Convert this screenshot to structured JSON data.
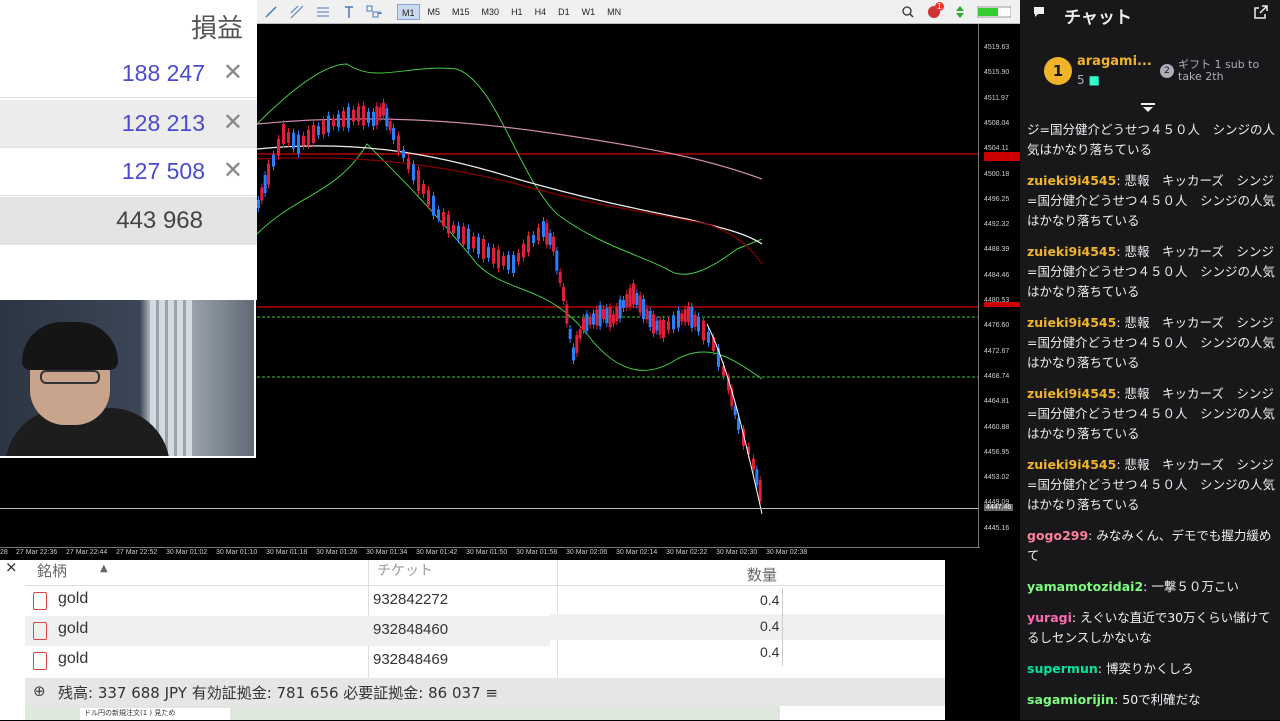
{
  "pl_panel": {
    "header": "損益",
    "rows": [
      {
        "value": "188 247",
        "close": "✕"
      },
      {
        "value": "128 213",
        "close": "✕"
      },
      {
        "value": "127 508",
        "close": "✕"
      }
    ],
    "total": "443 968"
  },
  "toolbar": {
    "timeframes": [
      "M1",
      "M5",
      "M15",
      "M30",
      "H1",
      "H4",
      "D1",
      "W1",
      "MN"
    ],
    "active_timeframe": "M1",
    "alert_badge": "1"
  },
  "price_axis": {
    "labels": [
      "4519.63",
      "4515.90",
      "4511.97",
      "4508.04",
      "4504.11",
      "4500.18",
      "4496.25",
      "4492.32",
      "4488.39",
      "4484.46",
      "4480.53",
      "4476.60",
      "4472.67",
      "4468.74",
      "4464.81",
      "4460.88",
      "4456.95",
      "4453.02",
      "4449.09",
      "4445.16"
    ],
    "current_price": "4447.46"
  },
  "time_axis": {
    "labels": [
      "28",
      "27 Mar 22:36",
      "27 Mar 22:44",
      "27 Mar 22:52",
      "30 Mar 01:02",
      "30 Mar 01:10",
      "30 Mar 01:18",
      "30 Mar 01:26",
      "30 Mar 01:34",
      "30 Mar 01:42",
      "30 Mar 01:50",
      "30 Mar 01:58",
      "30 Mar 02:06",
      "30 Mar 02:14",
      "30 Mar 02:22",
      "30 Mar 02:30",
      "30 Mar 02:38"
    ]
  },
  "positions": {
    "close": "×",
    "headers": {
      "symbol": "銘柄",
      "ticket": "チケット",
      "qty": "数量"
    },
    "rows": [
      {
        "symbol": "gold",
        "ticket": "932842272",
        "qty": "0.4"
      },
      {
        "symbol": "gold",
        "ticket": "932848460",
        "qty": "0.4"
      },
      {
        "symbol": "gold",
        "ticket": "932848469",
        "qty": "0.4"
      }
    ],
    "balance": "残高: 337 688 JPY  有効証拠金: 781 656  必要証拠金: 86 037  ≡"
  },
  "taskbar": {
    "tab": "ドル円の新規注文(1 ) 見ため"
  },
  "chat": {
    "title": "チャット",
    "gift": {
      "rank": "1",
      "user": "aragami...",
      "count": "5",
      "rank2": "2",
      "text": "ギフト 1 sub to take 2th"
    },
    "messages": [
      {
        "user": "",
        "color": "#efeff1",
        "text": "ジ=国分健介どうせつ４５０人　シンジの人気はかなり落ちている"
      },
      {
        "user": "zuieki9i4545",
        "color": "#f0b429",
        "text": "悲報　キッカーズ　シンジ=国分健介どうせつ４５０人　シンジの人気はかなり落ちている"
      },
      {
        "user": "zuieki9i4545",
        "color": "#f0b429",
        "text": "悲報　キッカーズ　シンジ=国分健介どうせつ４５０人　シンジの人気はかなり落ちている"
      },
      {
        "user": "zuieki9i4545",
        "color": "#f0b429",
        "text": "悲報　キッカーズ　シンジ=国分健介どうせつ４５０人　シンジの人気はかなり落ちている"
      },
      {
        "user": "zuieki9i4545",
        "color": "#f0b429",
        "text": "悲報　キッカーズ　シンジ=国分健介どうせつ４５０人　シンジの人気はかなり落ちている"
      },
      {
        "user": "zuieki9i4545",
        "color": "#f0b429",
        "text": "悲報　キッカーズ　シンジ=国分健介どうせつ４５０人　シンジの人気はかなり落ちている"
      },
      {
        "user": "gogo299",
        "color": "#ff7f9e",
        "text": "みなみくん、デモでも握力緩めて"
      },
      {
        "user": "yamamotozidai2",
        "color": "#7cfc7c",
        "text": "一撃５０万こい"
      },
      {
        "user": "yuragi",
        "color": "#ff69b4",
        "text": "えぐいな直近で30万くらい儲けてるしセンスしかないな"
      },
      {
        "user": "supermun",
        "color": "#00e5a0",
        "text": "博奕りかくしろ"
      },
      {
        "user": "sagamiorijin",
        "color": "#7cfc7c",
        "text": "50で利確だな"
      }
    ]
  }
}
